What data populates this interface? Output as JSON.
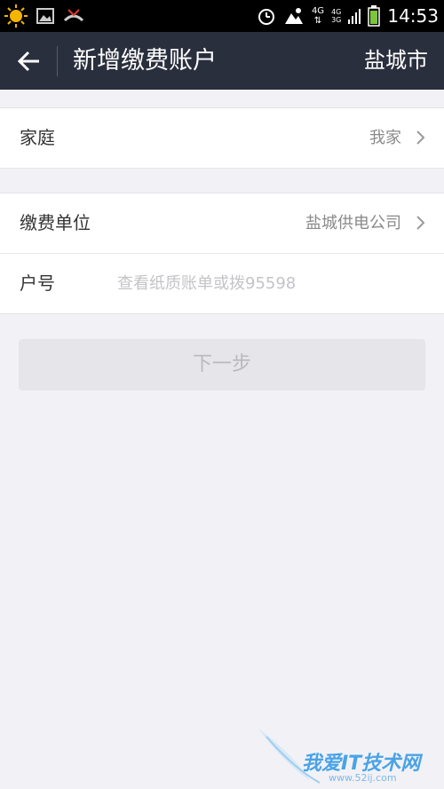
{
  "status_bar": {
    "time": "14:53",
    "network_top": "4G",
    "network_sub_1": "4G",
    "network_sub_2": "3G"
  },
  "header": {
    "title": "新增缴费账户",
    "city": "盐城市"
  },
  "group1": {
    "family_label": "家庭",
    "family_value": "我家"
  },
  "group2": {
    "unit_label": "缴费单位",
    "unit_value": "盐城供电公司",
    "account_label": "户号",
    "account_placeholder": "查看纸质账单或拨95598"
  },
  "next_button": "下一步",
  "watermark": {
    "text": "我爱IT技术网",
    "sub": "www.52ij.com"
  }
}
